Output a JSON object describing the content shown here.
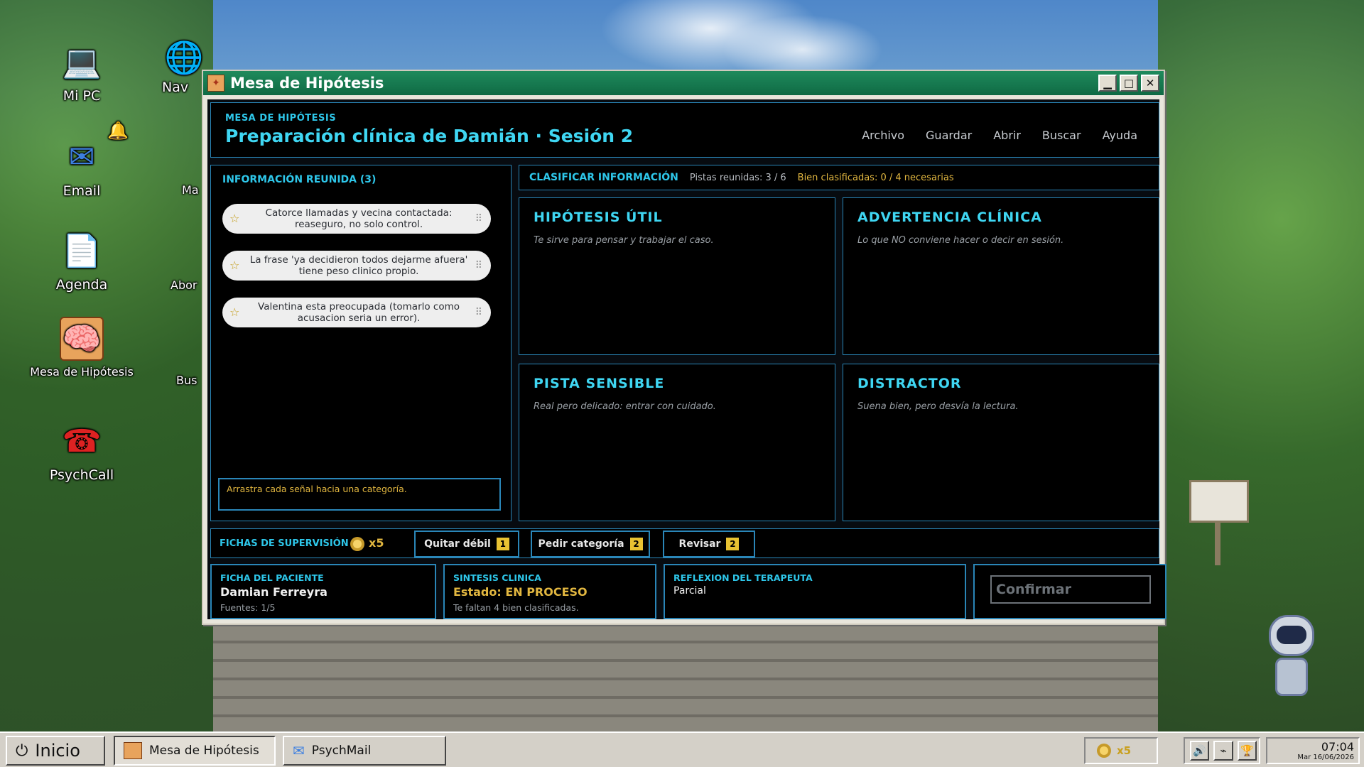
{
  "desktop": {
    "icons": [
      {
        "label": "Mi PC",
        "glyph": "💻",
        "icon": "computer-icon"
      },
      {
        "label": "Email",
        "glyph": "✉",
        "icon": "envelope-icon"
      },
      {
        "label": "Agenda",
        "glyph": "📄",
        "icon": "document-icon"
      },
      {
        "label": "Mesa de Hipótesis",
        "glyph": "🧠",
        "icon": "brain-book-icon"
      },
      {
        "label": "PsychCall",
        "glyph": "☎",
        "icon": "phone-icon"
      },
      {
        "label": "Nav",
        "glyph": "🌐",
        "icon": "browser-icon"
      },
      {
        "label": "Ma",
        "glyph": "",
        "icon": "app-icon"
      },
      {
        "label": "Abor",
        "glyph": "",
        "icon": "app-icon"
      },
      {
        "label": "Bus",
        "glyph": "",
        "icon": "app-icon"
      }
    ]
  },
  "window": {
    "title": "Mesa de Hipótesis",
    "controls": {
      "minimize": "▁",
      "maximize": "□",
      "close": "✕"
    }
  },
  "header": {
    "kicker": "MESA DE HIPÓTESIS",
    "title": "Preparación clínica de Damián · Sesión 2",
    "menu": [
      "Archivo",
      "Guardar",
      "Abrir",
      "Buscar",
      "Ayuda"
    ]
  },
  "info_panel": {
    "title": "INFORMACIÓN REUNIDA (3)",
    "items": [
      "Catorce llamadas y vecina contactada: reaseguro, no solo control.",
      "La frase 'ya decidieron todos dejarme afuera' tiene peso clinico propio.",
      "Valentina esta preocupada (tomarlo como acusacion seria un error)."
    ],
    "hint": "Arrastra cada señal hacia una categoría."
  },
  "classify": {
    "title": "CLASIFICAR INFORMACIÓN",
    "clues": "Pistas reunidas: 3 / 6",
    "correct": "Bien clasificadas: 0 / 4 necesarias",
    "categories": [
      {
        "name": "HIPÓTESIS ÚTIL",
        "desc": "Te sirve para pensar y trabajar el caso."
      },
      {
        "name": "ADVERTENCIA CLÍNICA",
        "desc": "Lo que NO conviene hacer o decir en sesión."
      },
      {
        "name": "PISTA SENSIBLE",
        "desc": "Real pero delicado: entrar con cuidado."
      },
      {
        "name": "DISTRACTOR",
        "desc": "Suena bien, pero desvía la lectura."
      }
    ]
  },
  "tokens": {
    "label": "FICHAS DE SUPERVISIÓN",
    "count": "x5",
    "actions": [
      {
        "label": "Quitar débil",
        "cost": "1"
      },
      {
        "label": "Pedir categoría",
        "cost": "2"
      },
      {
        "label": "Revisar",
        "cost": "2"
      }
    ]
  },
  "bottom": {
    "patient": {
      "label": "FICHA DEL PACIENTE",
      "name": "Damian Ferreyra",
      "sources": "Fuentes: 1/5"
    },
    "synthesis": {
      "label": "SINTESIS CLINICA",
      "status": "Estado: EN PROCESO",
      "note": "Te faltan 4 bien clasificadas."
    },
    "reflection": {
      "label": "REFLEXION DEL TERAPEUTA",
      "value": "Parcial"
    },
    "confirm": "Confirmar"
  },
  "taskbar": {
    "start": "Inicio",
    "tasks": [
      "Mesa de Hipótesis",
      "PsychMail"
    ],
    "tray_coins": "x5",
    "time": "07:04",
    "date": "Mar 16/06/2026"
  },
  "colors": {
    "accent": "#2ec7ea",
    "gold": "#e2b740",
    "titlebar": "#0f6a44"
  }
}
